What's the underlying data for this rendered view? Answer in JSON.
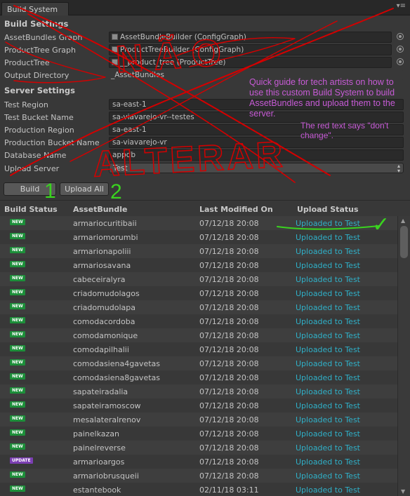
{
  "window": {
    "tab_title": "Build System",
    "menu_glyph": "▾≡"
  },
  "build_settings": {
    "title": "Build Settings",
    "fields": [
      {
        "label": "AssetBundles Graph",
        "value": "AssetBundleBuilder (ConfigGraph)"
      },
      {
        "label": "ProductTree Graph",
        "value": "ProductTreeBuilder (ConfigGraph)"
      },
      {
        "label": "ProductTree",
        "value": "__product_tree (ProductTree)"
      },
      {
        "label": "Output Directory",
        "value": "_AssetBundles"
      }
    ]
  },
  "server_settings": {
    "title": "Server Settings",
    "fields": [
      {
        "label": "Test Region",
        "value": "sa-east-1"
      },
      {
        "label": "Test Bucket Name",
        "value": "sa-viavarejo-vr--testes"
      },
      {
        "label": "Production Region",
        "value": "sa-east-1"
      },
      {
        "label": "Production Bucket Name",
        "value": "sa-viavarejo-vr"
      },
      {
        "label": "Database Name",
        "value": "appdb"
      }
    ],
    "upload_server": {
      "label": "Upload Server",
      "value": "Test"
    }
  },
  "buttons": {
    "build": "Build",
    "upload_all": "Upload All"
  },
  "table": {
    "headers": {
      "build_status": "Build Status",
      "asset_bundle": "AssetBundle",
      "last_modified": "Last Modified On",
      "upload_status": "Upload Status"
    },
    "rows": [
      {
        "badge": "NEW",
        "name": "armariocuritibaii",
        "date": "07/12/18 20:08",
        "status": "Uploaded to Test"
      },
      {
        "badge": "NEW",
        "name": "armariomorumbi",
        "date": "07/12/18 20:08",
        "status": "Uploaded to Test"
      },
      {
        "badge": "NEW",
        "name": "armarionapoliii",
        "date": "07/12/18 20:08",
        "status": "Uploaded to Test"
      },
      {
        "badge": "NEW",
        "name": "armariosavana",
        "date": "07/12/18 20:08",
        "status": "Uploaded to Test"
      },
      {
        "badge": "NEW",
        "name": "cabeceiralyra",
        "date": "07/12/18 20:08",
        "status": "Uploaded to Test"
      },
      {
        "badge": "NEW",
        "name": "criadomudolagos",
        "date": "07/12/18 20:08",
        "status": "Uploaded to Test"
      },
      {
        "badge": "NEW",
        "name": "criadomudolapa",
        "date": "07/12/18 20:08",
        "status": "Uploaded to Test"
      },
      {
        "badge": "NEW",
        "name": "comodacordoba",
        "date": "07/12/18 20:08",
        "status": "Uploaded to Test"
      },
      {
        "badge": "NEW",
        "name": "comodamonique",
        "date": "07/12/18 20:08",
        "status": "Uploaded to Test"
      },
      {
        "badge": "NEW",
        "name": "comodapilhalii",
        "date": "07/12/18 20:08",
        "status": "Uploaded to Test"
      },
      {
        "badge": "NEW",
        "name": "comodasiena4gavetas",
        "date": "07/12/18 20:08",
        "status": "Uploaded to Test"
      },
      {
        "badge": "NEW",
        "name": "comodasiena8gavetas",
        "date": "07/12/18 20:08",
        "status": "Uploaded to Test"
      },
      {
        "badge": "NEW",
        "name": "sapateiradalia",
        "date": "07/12/18 20:08",
        "status": "Uploaded to Test"
      },
      {
        "badge": "NEW",
        "name": "sapateiramoscow",
        "date": "07/12/18 20:08",
        "status": "Uploaded to Test"
      },
      {
        "badge": "NEW",
        "name": "mesalateralrenov",
        "date": "07/12/18 20:08",
        "status": "Uploaded to Test"
      },
      {
        "badge": "NEW",
        "name": "painelkazan",
        "date": "07/12/18 20:08",
        "status": "Uploaded to Test"
      },
      {
        "badge": "NEW",
        "name": "painelreverse",
        "date": "07/12/18 20:08",
        "status": "Uploaded to Test"
      },
      {
        "badge": "UPDATE",
        "name": "armarioargos",
        "date": "07/12/18 20:08",
        "status": "Uploaded to Test"
      },
      {
        "badge": "NEW",
        "name": "armariobrusqueii",
        "date": "07/12/18 20:08",
        "status": "Uploaded to Test"
      },
      {
        "badge": "NEW",
        "name": "estantebook",
        "date": "02/11/18 03:11",
        "status": "Uploaded to Test"
      }
    ]
  },
  "annotations": {
    "guide": "Quick guide for tech artists on how to use this custom Build System to build AssetBundles and upload them to the server.",
    "red_note": "The red text says \"don't change\".",
    "scrawl_top": "NÃO",
    "scrawl_bottom": "ALTERAR",
    "step1": "1",
    "step2": "2",
    "check": "✓",
    "colors": {
      "red": "#d40000",
      "green": "#3ad31f",
      "purple": "#c75bd6"
    }
  }
}
